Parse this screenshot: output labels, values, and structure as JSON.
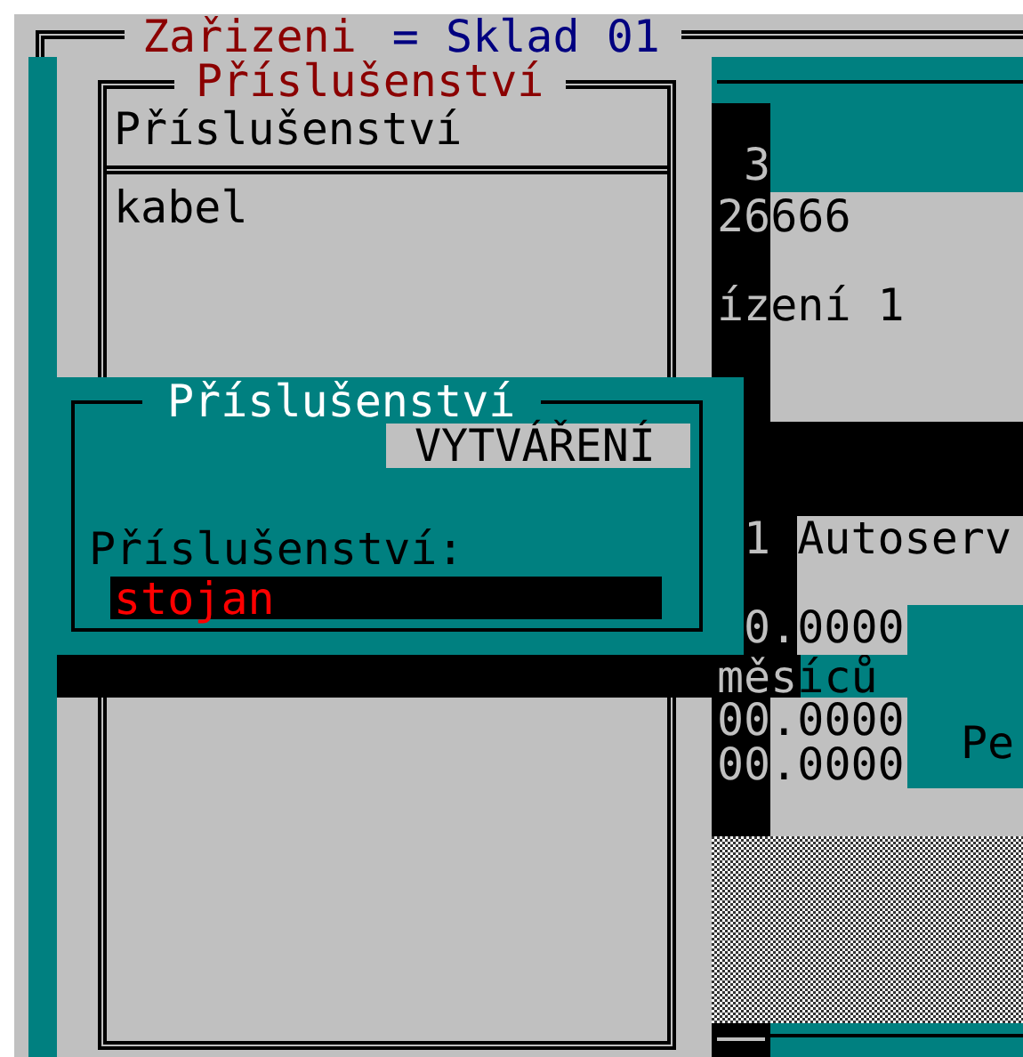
{
  "main_window": {
    "title_left": "Zařizeni",
    "title_right": "= Sklad 01"
  },
  "accessory_panel": {
    "title": "Příslušenství",
    "header": "Příslušenství",
    "items": [
      {
        "label": "kabel"
      }
    ]
  },
  "dialog": {
    "title": "Příslušenství",
    "mode": "VYTVÁŘENÍ",
    "field_label": "Příslušenství:",
    "field_value": "stojan"
  },
  "background_window": {
    "lines": [
      "3",
      "26666",
      "ízení 1",
      "1 Autoserv",
      "0.0000",
      "měsíců",
      "00.0000",
      "Pe",
      "00.0000"
    ]
  }
}
